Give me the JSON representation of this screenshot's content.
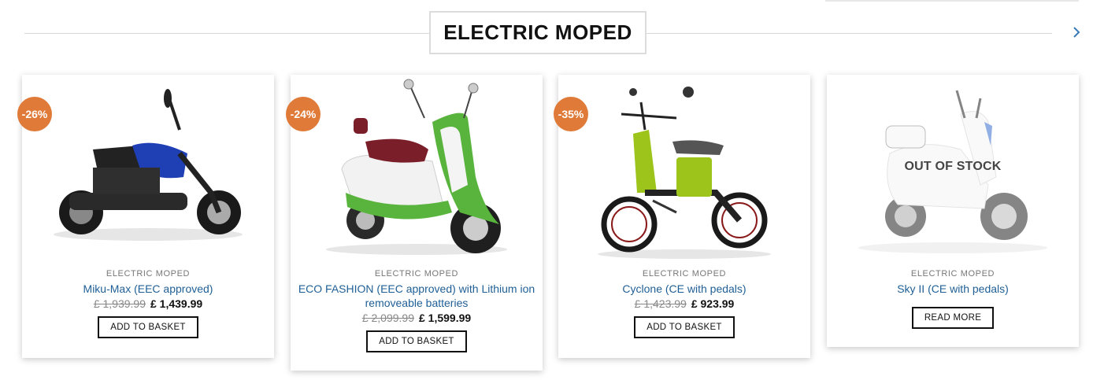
{
  "section": {
    "title": "ELECTRIC MOPED"
  },
  "products": [
    {
      "badge": "-26%",
      "category": "ELECTRIC MOPED",
      "name": "Miku-Max (EEC approved)",
      "old_price": "£ 1,939.99",
      "new_price": "£ 1,439.99",
      "button": "ADD TO BASKET",
      "accent": "#1f3fb5"
    },
    {
      "badge": "-24%",
      "category": "ELECTRIC MOPED",
      "name": "ECO FASHION (EEC approved) with Lithium ion removeable batteries",
      "old_price": "£ 2,099.99",
      "new_price": "£ 1,599.99",
      "button": "ADD TO BASKET",
      "accent": "#58b43c"
    },
    {
      "badge": "-35%",
      "category": "ELECTRIC MOPED",
      "name": "Cyclone (CE with pedals)",
      "old_price": "£ 1,423.99",
      "new_price": "£ 923.99",
      "button": "ADD TO BASKET",
      "accent": "#9cc41a"
    },
    {
      "status": "OUT OF STOCK",
      "category": "ELECTRIC MOPED",
      "name": "Sky II (CE with pedals)",
      "button": "READ MORE",
      "accent": "#f2f2f2"
    }
  ],
  "colors": {
    "badge": "#e07a38",
    "link": "#1f5f96"
  },
  "icons": {
    "next": "chevron-right-icon"
  }
}
